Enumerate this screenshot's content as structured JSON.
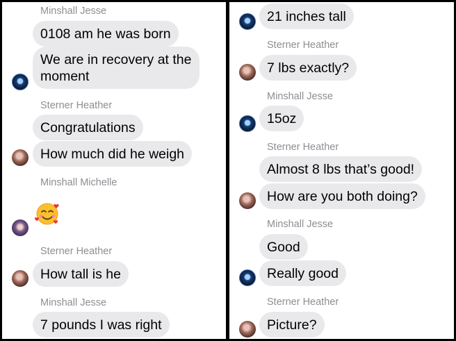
{
  "left": {
    "messages": [
      {
        "sender": "Minshall Jesse"
      },
      {
        "text": "0108 am he was born"
      },
      {
        "text": "We are in recovery at the moment"
      },
      {
        "sender": "Sterner Heather"
      },
      {
        "text": "Congratulations"
      },
      {
        "text": "How much did he weigh"
      },
      {
        "sender": "Minshall Michelle"
      },
      {
        "emoji": "smiling-face-with-hearts"
      },
      {
        "sender": "Sterner Heather"
      },
      {
        "text": "How tall is he"
      },
      {
        "sender": "Minshall Jesse"
      },
      {
        "text": "7 pounds I was right"
      }
    ]
  },
  "right": {
    "messages": [
      {
        "text": "21 inches tall"
      },
      {
        "sender": "Sterner Heather"
      },
      {
        "text": "7 lbs exactly?"
      },
      {
        "sender": "Minshall Jesse"
      },
      {
        "text": "15oz"
      },
      {
        "sender": "Sterner Heather"
      },
      {
        "text": "Almost 8 lbs that’s good!"
      },
      {
        "text": "How are you both doing?"
      },
      {
        "sender": "Minshall Jesse"
      },
      {
        "text": "Good"
      },
      {
        "text": "Really good"
      },
      {
        "sender": "Sterner Heather"
      },
      {
        "text": "Picture?"
      }
    ]
  },
  "colors": {
    "bubble": "#e9e9eb",
    "sender_name": "#8e8e93",
    "divider": "#000000"
  }
}
